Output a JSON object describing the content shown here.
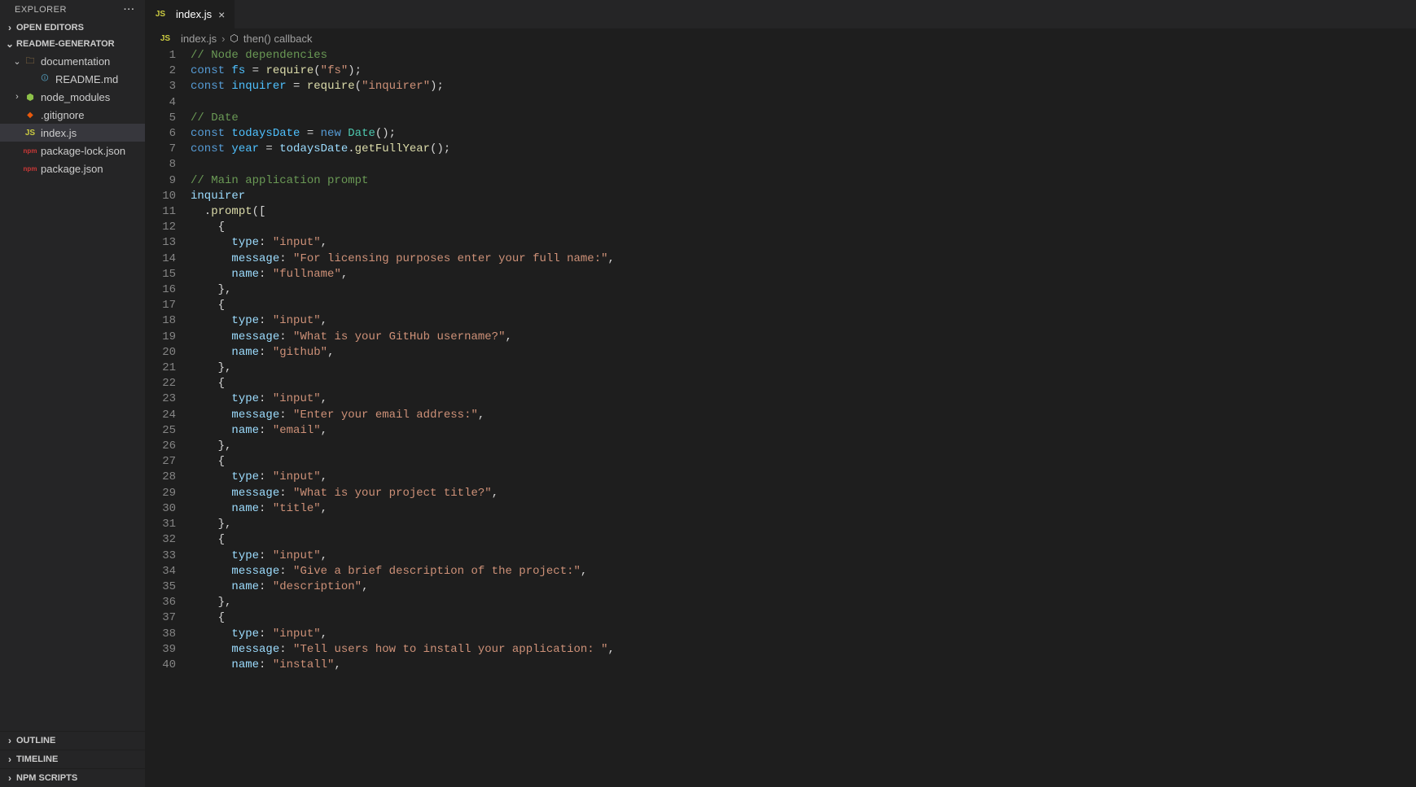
{
  "sidebar": {
    "title": "EXPLORER",
    "openEditors": "OPEN EDITORS",
    "project": "README-GENERATOR",
    "outline": "OUTLINE",
    "timeline": "TIMELINE",
    "npm": "NPM SCRIPTS",
    "items": [
      {
        "depth": 1,
        "chev": "v",
        "icon": "folder",
        "label": "documentation"
      },
      {
        "depth": 2,
        "chev": "",
        "icon": "md",
        "label": "README.md"
      },
      {
        "depth": 1,
        "chev": ">",
        "icon": "nodemod",
        "label": "node_modules"
      },
      {
        "depth": 1,
        "chev": "",
        "icon": "git",
        "label": ".gitignore"
      },
      {
        "depth": 1,
        "chev": "",
        "icon": "js",
        "label": "index.js",
        "active": true
      },
      {
        "depth": 1,
        "chev": "",
        "icon": "npm",
        "label": "package-lock.json"
      },
      {
        "depth": 1,
        "chev": "",
        "icon": "npm",
        "label": "package.json"
      }
    ]
  },
  "tab": {
    "label": "index.js"
  },
  "crumbs": {
    "file": "index.js",
    "symbol": "then() callback"
  },
  "code": [
    [
      {
        "t": "// Node dependencies",
        "c": "c-com"
      }
    ],
    [
      {
        "t": "const ",
        "c": "c-kw"
      },
      {
        "t": "fs",
        "c": "c-var"
      },
      {
        "t": " = ",
        "c": "c-pun"
      },
      {
        "t": "require",
        "c": "c-fn"
      },
      {
        "t": "(",
        "c": "c-pun"
      },
      {
        "t": "\"fs\"",
        "c": "c-str"
      },
      {
        "t": ");",
        "c": "c-pun"
      }
    ],
    [
      {
        "t": "const ",
        "c": "c-kw"
      },
      {
        "t": "inquirer",
        "c": "c-var"
      },
      {
        "t": " = ",
        "c": "c-pun"
      },
      {
        "t": "require",
        "c": "c-fn"
      },
      {
        "t": "(",
        "c": "c-pun"
      },
      {
        "t": "\"inquirer\"",
        "c": "c-str"
      },
      {
        "t": ");",
        "c": "c-pun"
      }
    ],
    [],
    [
      {
        "t": "// Date",
        "c": "c-com"
      }
    ],
    [
      {
        "t": "const ",
        "c": "c-kw"
      },
      {
        "t": "todaysDate",
        "c": "c-var"
      },
      {
        "t": " = ",
        "c": "c-pun"
      },
      {
        "t": "new ",
        "c": "c-kw"
      },
      {
        "t": "Date",
        "c": "c-cls"
      },
      {
        "t": "();",
        "c": "c-pun"
      }
    ],
    [
      {
        "t": "const ",
        "c": "c-kw"
      },
      {
        "t": "year",
        "c": "c-var"
      },
      {
        "t": " = ",
        "c": "c-pun"
      },
      {
        "t": "todaysDate",
        "c": "c-prop"
      },
      {
        "t": ".",
        "c": "c-pun"
      },
      {
        "t": "getFullYear",
        "c": "c-fn"
      },
      {
        "t": "();",
        "c": "c-pun"
      }
    ],
    [],
    [
      {
        "t": "// Main application prompt",
        "c": "c-com"
      }
    ],
    [
      {
        "t": "inquirer",
        "c": "c-prop"
      }
    ],
    [
      {
        "t": "  .",
        "c": "c-pun"
      },
      {
        "t": "prompt",
        "c": "c-fn"
      },
      {
        "t": "([",
        "c": "c-pun"
      }
    ],
    [
      {
        "t": "    {",
        "c": "c-pun"
      }
    ],
    [
      {
        "t": "      ",
        "c": ""
      },
      {
        "t": "type",
        "c": "c-prop"
      },
      {
        "t": ": ",
        "c": "c-pun"
      },
      {
        "t": "\"input\"",
        "c": "c-str"
      },
      {
        "t": ",",
        "c": "c-pun"
      }
    ],
    [
      {
        "t": "      ",
        "c": ""
      },
      {
        "t": "message",
        "c": "c-prop"
      },
      {
        "t": ": ",
        "c": "c-pun"
      },
      {
        "t": "\"For licensing purposes enter your full name:\"",
        "c": "c-str"
      },
      {
        "t": ",",
        "c": "c-pun"
      }
    ],
    [
      {
        "t": "      ",
        "c": ""
      },
      {
        "t": "name",
        "c": "c-prop"
      },
      {
        "t": ": ",
        "c": "c-pun"
      },
      {
        "t": "\"fullname\"",
        "c": "c-str"
      },
      {
        "t": ",",
        "c": "c-pun"
      }
    ],
    [
      {
        "t": "    },",
        "c": "c-pun"
      }
    ],
    [
      {
        "t": "    {",
        "c": "c-pun"
      }
    ],
    [
      {
        "t": "      ",
        "c": ""
      },
      {
        "t": "type",
        "c": "c-prop"
      },
      {
        "t": ": ",
        "c": "c-pun"
      },
      {
        "t": "\"input\"",
        "c": "c-str"
      },
      {
        "t": ",",
        "c": "c-pun"
      }
    ],
    [
      {
        "t": "      ",
        "c": ""
      },
      {
        "t": "message",
        "c": "c-prop"
      },
      {
        "t": ": ",
        "c": "c-pun"
      },
      {
        "t": "\"What is your GitHub username?\"",
        "c": "c-str"
      },
      {
        "t": ",",
        "c": "c-pun"
      }
    ],
    [
      {
        "t": "      ",
        "c": ""
      },
      {
        "t": "name",
        "c": "c-prop"
      },
      {
        "t": ": ",
        "c": "c-pun"
      },
      {
        "t": "\"github\"",
        "c": "c-str"
      },
      {
        "t": ",",
        "c": "c-pun"
      }
    ],
    [
      {
        "t": "    },",
        "c": "c-pun"
      }
    ],
    [
      {
        "t": "    {",
        "c": "c-pun"
      }
    ],
    [
      {
        "t": "      ",
        "c": ""
      },
      {
        "t": "type",
        "c": "c-prop"
      },
      {
        "t": ": ",
        "c": "c-pun"
      },
      {
        "t": "\"input\"",
        "c": "c-str"
      },
      {
        "t": ",",
        "c": "c-pun"
      }
    ],
    [
      {
        "t": "      ",
        "c": ""
      },
      {
        "t": "message",
        "c": "c-prop"
      },
      {
        "t": ": ",
        "c": "c-pun"
      },
      {
        "t": "\"Enter your email address:\"",
        "c": "c-str"
      },
      {
        "t": ",",
        "c": "c-pun"
      }
    ],
    [
      {
        "t": "      ",
        "c": ""
      },
      {
        "t": "name",
        "c": "c-prop"
      },
      {
        "t": ": ",
        "c": "c-pun"
      },
      {
        "t": "\"email\"",
        "c": "c-str"
      },
      {
        "t": ",",
        "c": "c-pun"
      }
    ],
    [
      {
        "t": "    },",
        "c": "c-pun"
      }
    ],
    [
      {
        "t": "    {",
        "c": "c-pun"
      }
    ],
    [
      {
        "t": "      ",
        "c": ""
      },
      {
        "t": "type",
        "c": "c-prop"
      },
      {
        "t": ": ",
        "c": "c-pun"
      },
      {
        "t": "\"input\"",
        "c": "c-str"
      },
      {
        "t": ",",
        "c": "c-pun"
      }
    ],
    [
      {
        "t": "      ",
        "c": ""
      },
      {
        "t": "message",
        "c": "c-prop"
      },
      {
        "t": ": ",
        "c": "c-pun"
      },
      {
        "t": "\"What is your project title?\"",
        "c": "c-str"
      },
      {
        "t": ",",
        "c": "c-pun"
      }
    ],
    [
      {
        "t": "      ",
        "c": ""
      },
      {
        "t": "name",
        "c": "c-prop"
      },
      {
        "t": ": ",
        "c": "c-pun"
      },
      {
        "t": "\"title\"",
        "c": "c-str"
      },
      {
        "t": ",",
        "c": "c-pun"
      }
    ],
    [
      {
        "t": "    },",
        "c": "c-pun"
      }
    ],
    [
      {
        "t": "    {",
        "c": "c-pun"
      }
    ],
    [
      {
        "t": "      ",
        "c": ""
      },
      {
        "t": "type",
        "c": "c-prop"
      },
      {
        "t": ": ",
        "c": "c-pun"
      },
      {
        "t": "\"input\"",
        "c": "c-str"
      },
      {
        "t": ",",
        "c": "c-pun"
      }
    ],
    [
      {
        "t": "      ",
        "c": ""
      },
      {
        "t": "message",
        "c": "c-prop"
      },
      {
        "t": ": ",
        "c": "c-pun"
      },
      {
        "t": "\"Give a brief description of the project:\"",
        "c": "c-str"
      },
      {
        "t": ",",
        "c": "c-pun"
      }
    ],
    [
      {
        "t": "      ",
        "c": ""
      },
      {
        "t": "name",
        "c": "c-prop"
      },
      {
        "t": ": ",
        "c": "c-pun"
      },
      {
        "t": "\"description\"",
        "c": "c-str"
      },
      {
        "t": ",",
        "c": "c-pun"
      }
    ],
    [
      {
        "t": "    },",
        "c": "c-pun"
      }
    ],
    [
      {
        "t": "    {",
        "c": "c-pun"
      }
    ],
    [
      {
        "t": "      ",
        "c": ""
      },
      {
        "t": "type",
        "c": "c-prop"
      },
      {
        "t": ": ",
        "c": "c-pun"
      },
      {
        "t": "\"input\"",
        "c": "c-str"
      },
      {
        "t": ",",
        "c": "c-pun"
      }
    ],
    [
      {
        "t": "      ",
        "c": ""
      },
      {
        "t": "message",
        "c": "c-prop"
      },
      {
        "t": ": ",
        "c": "c-pun"
      },
      {
        "t": "\"Tell users how to install your application: \"",
        "c": "c-str"
      },
      {
        "t": ",",
        "c": "c-pun"
      }
    ],
    [
      {
        "t": "      ",
        "c": ""
      },
      {
        "t": "name",
        "c": "c-prop"
      },
      {
        "t": ": ",
        "c": "c-pun"
      },
      {
        "t": "\"install\"",
        "c": "c-str"
      },
      {
        "t": ",",
        "c": "c-pun"
      }
    ]
  ],
  "iconText": {
    "folder": "🗀",
    "js": "JS",
    "md": "🛈",
    "npm": "npm",
    "git": "◆",
    "nodemod": "⬢"
  }
}
